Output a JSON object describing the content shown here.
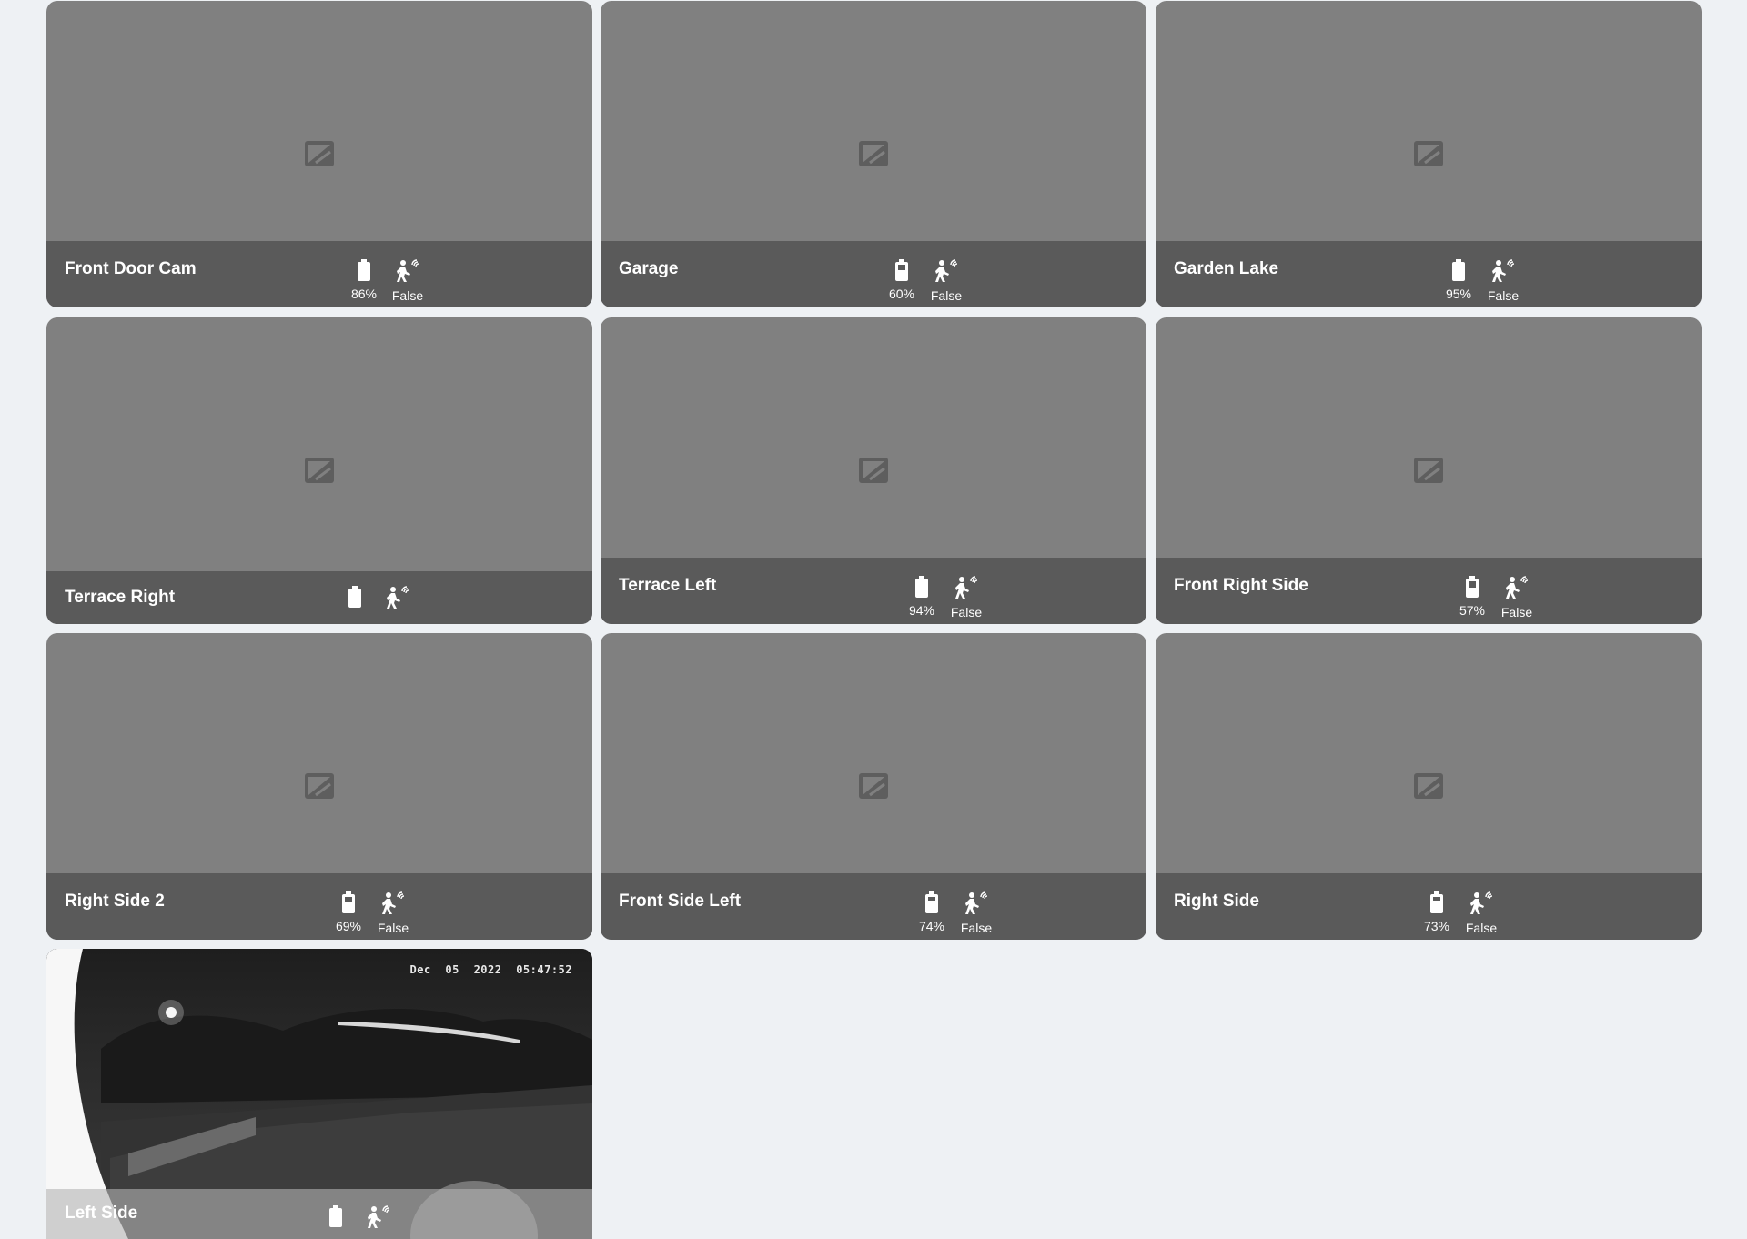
{
  "cameras": [
    {
      "name": "Front Door Cam",
      "battery": "86%",
      "motion": "False"
    },
    {
      "name": "Garage",
      "battery": "60%",
      "motion": "False"
    },
    {
      "name": "Garden Lake",
      "battery": "95%",
      "motion": "False"
    },
    {
      "name": "Terrace Right",
      "battery": "",
      "motion": ""
    },
    {
      "name": "Terrace Left",
      "battery": "94%",
      "motion": "False"
    },
    {
      "name": "Front Right Side",
      "battery": "57%",
      "motion": "False"
    },
    {
      "name": "Right Side 2",
      "battery": "69%",
      "motion": "False"
    },
    {
      "name": "Front Side Left",
      "battery": "74%",
      "motion": "False"
    },
    {
      "name": "Right Side",
      "battery": "73%",
      "motion": "False"
    },
    {
      "name": "Left Side",
      "battery": "",
      "motion": "",
      "timestamp": "Dec 05 2022 05:47:52"
    }
  ],
  "icons": {
    "placeholder": "broken-image-icon",
    "battery": "battery-icon",
    "motion": "motion-sensor-icon"
  },
  "colors": {
    "background": "#eef1f4",
    "card": "#808080",
    "footer": "#5a5a5a",
    "text": "#ffffff"
  }
}
